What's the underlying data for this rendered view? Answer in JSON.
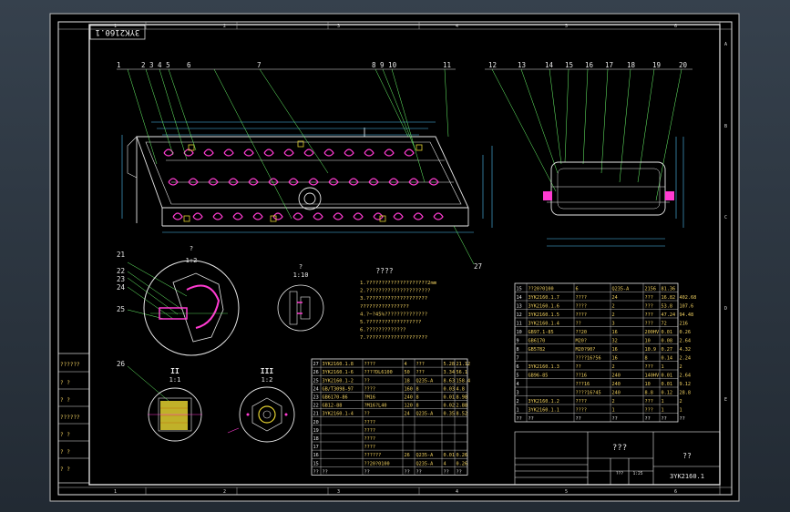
{
  "drawing": {
    "code_rotated": "3YK2160.1",
    "title_block": {
      "name": "???",
      "label_right": "??",
      "code": "3YK2160.1",
      "small": [
        "1:25",
        "???"
      ]
    },
    "zone_numbers_top": [
      "1",
      "2",
      "3",
      "4",
      "5",
      "6"
    ],
    "zone_letters": [
      "A",
      "B",
      "C",
      "D",
      "E"
    ],
    "callouts_top": [
      "1",
      "2 3 4 5",
      "6",
      "7",
      "8 9 10",
      "11",
      "12",
      "13",
      "14",
      "15",
      "16",
      "17",
      "18",
      "19",
      "20"
    ],
    "callout_27": "27",
    "detail_labels": {
      "ii": "?",
      "ii_scale": "1:2",
      "small": "?",
      "small_scale": "1:10",
      "section_ii": "II",
      "section_ii_scale": "1:1",
      "section_iii": "III",
      "section_iii_scale": "1:2",
      "c21": "21",
      "c22": "22",
      "c23": "23",
      "c24": "24",
      "c25": "25",
      "c26": "26"
    },
    "notes_title": "????",
    "notes": [
      "1.????????????????????2mm",
      "2.?????????????????????",
      "3.????????????????????",
      "  ????????????????",
      "4.?~?45%??????????????",
      "5.??????????????????",
      "6.?????????????",
      "7.????????????????????"
    ],
    "left_column_text": [
      "??????",
      "?  ?",
      "?  ?",
      "??????",
      "?  ?",
      "?  ?",
      "?  ?"
    ],
    "bom_left": [
      [
        "27",
        "3YK2160.1.8",
        "????",
        "4",
        "???",
        "5.28",
        "21.12"
      ],
      [
        "26",
        "3YK2160.1-6",
        "????DL6100",
        "50",
        "???",
        "3.34",
        "56.1"
      ],
      [
        "25",
        "3YK2160.1-2",
        "??",
        "18",
        "Q235-A",
        "8.63",
        "158.4"
      ],
      [
        "24",
        "GB/T3098-97",
        "????",
        "160",
        "8",
        "0.03",
        "4.8"
      ],
      [
        "23",
        "GB6170-86",
        "?M16",
        "240",
        "8",
        "0.01",
        "8.98"
      ],
      [
        "22",
        "GB12-88",
        "?M16?L40",
        "120",
        "8",
        "0.02",
        "2.88"
      ],
      [
        "21",
        "3YK2160.1-4",
        "??",
        "24",
        "Q235-A",
        "0.35",
        "8.52"
      ],
      [
        "20",
        "",
        "????",
        "",
        "",
        "",
        ""
      ],
      [
        "19",
        "",
        "????",
        "",
        "",
        "",
        ""
      ],
      [
        "18",
        "",
        "????",
        "",
        "",
        "",
        ""
      ],
      [
        "17",
        "",
        "????",
        "",
        "",
        "",
        ""
      ],
      [
        "16",
        "",
        "??????",
        "26",
        "Q235-A",
        "0.01",
        "0.26"
      ],
      [
        "15",
        "",
        "??20?0100",
        "",
        "Q235-A",
        "4",
        "0.26"
      ],
      [
        "??",
        "??",
        "??",
        "??",
        "??",
        "??",
        "??"
      ]
    ],
    "bom_right": [
      [
        "15",
        "??20?0100",
        "6",
        "Q235-A",
        "2156",
        "81.36"
      ],
      [
        "14",
        "3YK2160.1.7",
        "????",
        "24",
        "???",
        "16.82",
        "402.68"
      ],
      [
        "13",
        "3YK2160.1.6",
        "????",
        "2",
        "???",
        "53.8",
        "107.6"
      ],
      [
        "12",
        "3YK2160.1.5",
        "????",
        "2",
        "???",
        "47.24",
        "94.48"
      ],
      [
        "11",
        "3YK2160.1.4",
        "??",
        "3",
        "???",
        "72",
        "216"
      ],
      [
        "10",
        "GB97.1-85",
        "??20",
        "16",
        "200HV",
        "0.01",
        "0.26"
      ],
      [
        "9",
        "GB6170",
        "M20?",
        "32",
        "10",
        "0.08",
        "2.64"
      ],
      [
        "8",
        "GB5782",
        "M20?90?",
        "16",
        "10.9",
        "0.27",
        "4.32"
      ],
      [
        "7",
        "",
        "????16?56",
        "16",
        "8",
        "0.14",
        "2.24"
      ],
      [
        "6",
        "3YK2160.1.3",
        "??",
        "2",
        "???",
        "1",
        "2"
      ],
      [
        "5",
        "GB96-85",
        "??16",
        "240",
        "140HV",
        "0.01",
        "2.64"
      ],
      [
        "4",
        "",
        "???16",
        "240",
        "10",
        "0.01",
        "9.12"
      ],
      [
        "3",
        "",
        "????16?45",
        "240",
        "8.8",
        "0.12",
        "28.8"
      ],
      [
        "2",
        "3YK2160.1.2",
        "????",
        "2",
        "???",
        "1",
        "2"
      ],
      [
        "1",
        "3YK2160.1.1",
        "????",
        "1",
        "???",
        "1",
        "1"
      ],
      [
        "??",
        "??",
        "??",
        "??",
        "??",
        "??",
        "??"
      ]
    ]
  }
}
